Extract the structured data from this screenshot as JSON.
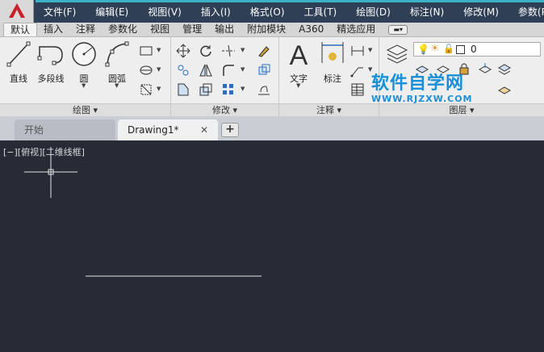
{
  "menu_bar": {
    "items": [
      "文件(F)",
      "编辑(E)",
      "视图(V)",
      "插入(I)",
      "格式(O)",
      "工具(T)",
      "绘图(D)",
      "标注(N)",
      "修改(M)",
      "参数(P)"
    ]
  },
  "ribbon_tabs": {
    "items": [
      "默认",
      "插入",
      "注释",
      "参数化",
      "视图",
      "管理",
      "输出",
      "附加模块",
      "A360",
      "精选应用"
    ],
    "active": "默认"
  },
  "draw_panel": {
    "tools": [
      "直线",
      "多段线",
      "圆",
      "圆弧"
    ],
    "title": "绘图"
  },
  "modify_panel": {
    "title": "修改"
  },
  "annotation_panel": {
    "tools": [
      "文字",
      "标注"
    ],
    "title": "注释"
  },
  "layers_panel": {
    "layer_value": "0",
    "title": "图层"
  },
  "watermark": {
    "title": "软件自学网",
    "url": "WWW.RJZXW.COM"
  },
  "file_tabs": {
    "items": [
      "开始",
      "Drawing1*"
    ],
    "close_symbol": "✕",
    "add_symbol": "+"
  },
  "viewport": {
    "label": "[−][俯视][二维线框]"
  },
  "colors": {
    "menu_bg": "#2f3f55",
    "accent": "#38b2c4",
    "canvas_bg": "#262b35",
    "watermark": "#1a8fd6"
  }
}
